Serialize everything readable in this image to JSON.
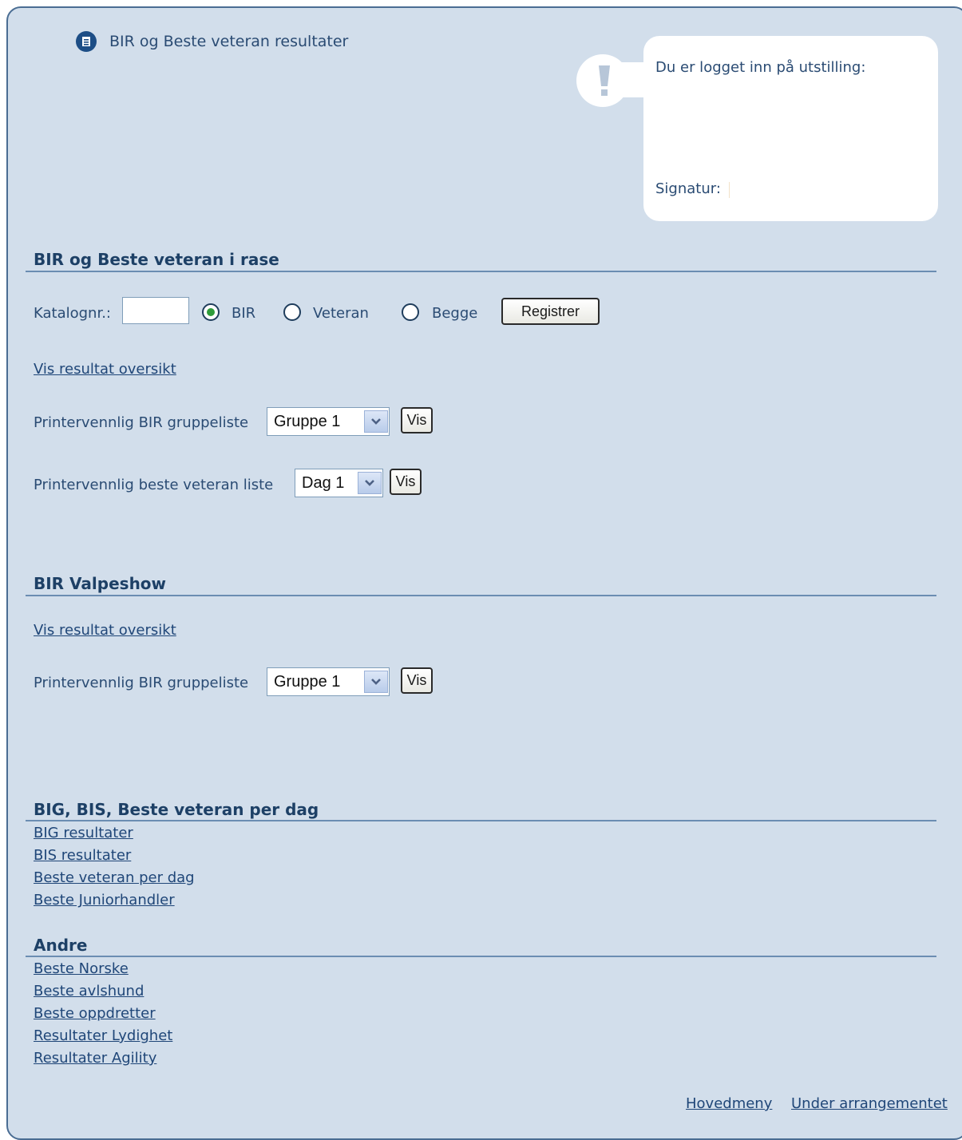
{
  "header": {
    "title": "BIR og Beste veteran resultater",
    "icon": "document-icon"
  },
  "info": {
    "logged_in_label": "Du er logget inn på utstilling:",
    "signature_label": "Signatur:",
    "icon": "exclamation-icon"
  },
  "section_bir": {
    "title": "BIR og Beste veteran i rase",
    "katalog_label": "Katalognr.:",
    "katalog_value": "",
    "radio_options": [
      {
        "label": "BIR",
        "selected": true
      },
      {
        "label": "Veteran",
        "selected": false
      },
      {
        "label": "Begge",
        "selected": false
      }
    ],
    "register_button": "Registrer",
    "overview_link": "Vis resultat oversikt",
    "group_list_label": "Printervennlig BIR gruppeliste",
    "group_list_value": "Gruppe 1",
    "group_list_button": "Vis",
    "veteran_list_label": "Printervennlig beste veteran liste",
    "veteran_list_value": "Dag 1",
    "veteran_list_button": "Vis"
  },
  "section_puppy": {
    "title": "BIR Valpeshow",
    "overview_link": "Vis resultat oversikt",
    "group_list_label": "Printervennlig BIR gruppeliste",
    "group_list_value": "Gruppe 1",
    "group_list_button": "Vis"
  },
  "section_big": {
    "title": "BIG, BIS, Beste veteran per dag",
    "links": [
      "BIG resultater",
      "BIS resultater",
      "Beste veteran per dag",
      "Beste Juniorhandler"
    ]
  },
  "section_other": {
    "title": "Andre",
    "links": [
      "Beste Norske",
      "Beste avlshund ",
      "Beste oppdretter",
      "Resultater Lydighet ",
      "Resultater Agility"
    ]
  },
  "footer": {
    "links": [
      "Hovedmeny",
      "Under arrangementet"
    ]
  },
  "colors": {
    "panel_bg": "#d2deeb",
    "heading": "#1d4066",
    "link": "#1f4678",
    "radio_selected": "#2f9c3a"
  }
}
